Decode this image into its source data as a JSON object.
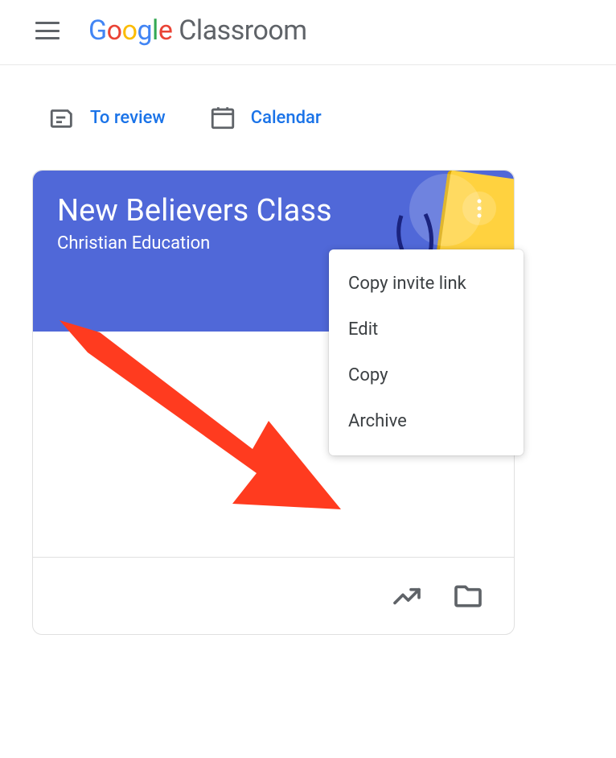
{
  "header": {
    "product_suffix": " Classroom"
  },
  "actions": {
    "review": "To review",
    "calendar": "Calendar"
  },
  "card": {
    "title": "New Believers Class",
    "subtitle": "Christian Education"
  },
  "menu": {
    "items": [
      {
        "label": "Copy invite link"
      },
      {
        "label": "Edit"
      },
      {
        "label": "Copy"
      },
      {
        "label": "Archive"
      }
    ]
  }
}
